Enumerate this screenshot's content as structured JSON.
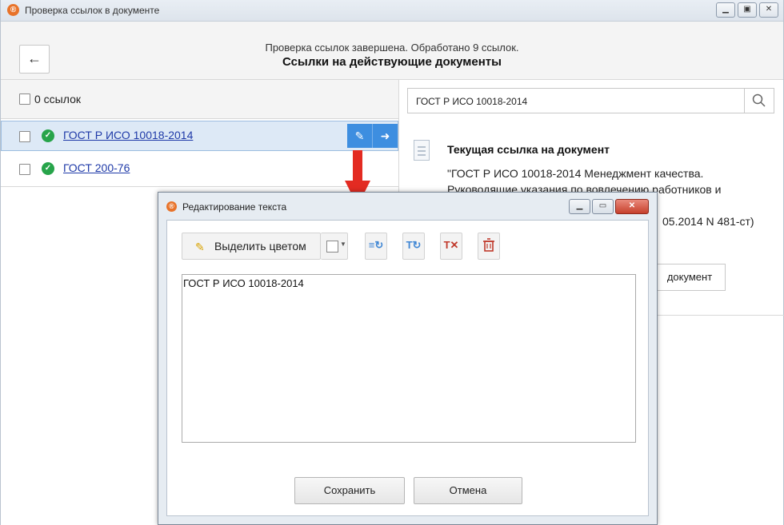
{
  "window": {
    "title": "Проверка ссылок в документе",
    "app_icon": "app-logo-icon",
    "controls": [
      "minimize",
      "maximize",
      "close"
    ]
  },
  "header": {
    "back_icon": "arrow-left-icon",
    "status": "Проверка ссылок завершена. Обработано 9 ссылок.",
    "title": "Ссылки на действующие документы"
  },
  "left": {
    "count_label": "0 ссылок",
    "references": [
      {
        "label": "ГОСТ Р ИСО 10018-2014",
        "status": "valid",
        "selected": true
      },
      {
        "label": "ГОСТ 200-76",
        "status": "valid",
        "selected": false
      }
    ],
    "row_actions": [
      "edit-icon",
      "go-to-icon"
    ]
  },
  "right": {
    "search_value": "ГОСТ Р ИСО 10018-2014",
    "search_icon": "search-icon",
    "current_ref_title": "Текущая ссылка на документ",
    "current_ref_text": "\"ГОСТ Р ИСО 10018-2014 Менеджмент качества. Руководящие указания по вовлечению работников и",
    "current_ref_tail": "05.2014 N 481-ст)",
    "open_button_visible_text": "документ"
  },
  "dialog": {
    "title": "Редактирование текста",
    "highlight_label": "Выделить цветом",
    "tool_icons": [
      "highlight-pencil-icon",
      "color-swatch-icon",
      "replace-format-icon",
      "clear-format-icon",
      "remove-format-icon",
      "delete-icon"
    ],
    "text_value": "ГОСТ Р ИСО 10018-2014",
    "save_label": "Сохранить",
    "cancel_label": "Отмена"
  },
  "colors": {
    "accent": "#3d8ee0",
    "link": "#1f3aa8",
    "ok_green": "#27a44a",
    "arrow_red": "#e32b22",
    "close_red": "#c6402c"
  }
}
